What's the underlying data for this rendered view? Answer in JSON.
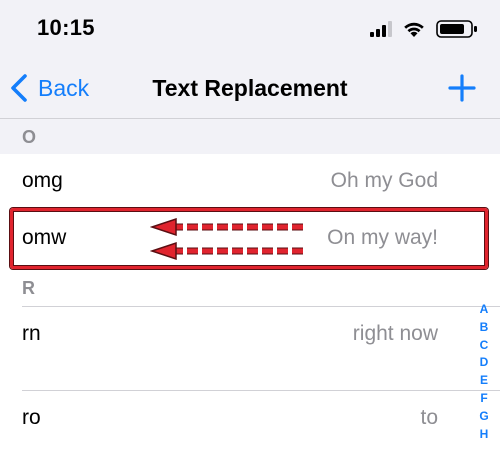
{
  "status_bar": {
    "time": "10:15",
    "icons": [
      "signal-icon",
      "wifi-icon",
      "battery-icon"
    ]
  },
  "nav": {
    "back_label": "Back",
    "title": "Text Replacement",
    "add_icon": "plus-icon"
  },
  "sections": [
    {
      "header": "O",
      "rows": [
        {
          "phrase": "omg",
          "shortcut": "Oh my God"
        },
        {
          "phrase": "omw",
          "shortcut": "On my way!",
          "highlighted": true
        }
      ]
    },
    {
      "header": "R",
      "rows": [
        {
          "phrase": "rn",
          "shortcut": "right now"
        },
        {
          "phrase": "ro",
          "shortcut": "to"
        }
      ]
    }
  ],
  "index_letters": [
    "A",
    "B",
    "C",
    "D",
    "E",
    "F",
    "G",
    "H"
  ],
  "colors": {
    "accent": "#147efb",
    "background": "#f2f2f7",
    "secondary_text": "#8e8e93",
    "annotation_red": "#e0242e"
  }
}
